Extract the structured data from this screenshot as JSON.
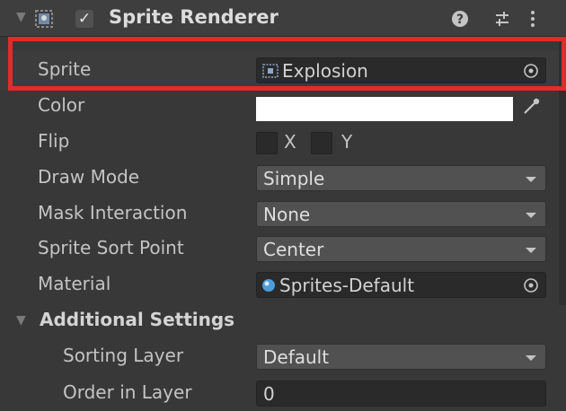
{
  "component": {
    "title": "Sprite Renderer",
    "enabled": true,
    "enabled_glyph": "✓"
  },
  "properties": {
    "sprite": {
      "label": "Sprite",
      "value": "Explosion"
    },
    "color": {
      "label": "Color",
      "value": "#ffffff"
    },
    "flip": {
      "label": "Flip",
      "x_label": "X",
      "y_label": "Y",
      "x_checked": false,
      "y_checked": false
    },
    "draw_mode": {
      "label": "Draw Mode",
      "value": "Simple"
    },
    "mask_interaction": {
      "label": "Mask Interaction",
      "value": "None"
    },
    "sprite_sort_point": {
      "label": "Sprite Sort Point",
      "value": "Center"
    },
    "material": {
      "label": "Material",
      "value": "Sprites-Default"
    }
  },
  "additional_settings": {
    "label": "Additional Settings",
    "sorting_layer": {
      "label": "Sorting Layer",
      "value": "Default"
    },
    "order_in_layer": {
      "label": "Order in Layer",
      "value": "0"
    }
  },
  "colors": {
    "highlight": "#e22b2b",
    "panel": "#383838",
    "field": "#2a2a2a",
    "dropdown": "#515151"
  },
  "icons": [
    "foldout-arrow-icon",
    "sprite-renderer-icon",
    "help-icon",
    "presets-icon",
    "more-menu-icon",
    "object-picker-icon",
    "eyedropper-icon",
    "sprite-asset-icon",
    "material-sphere-icon",
    "dropdown-caret-icon"
  ]
}
